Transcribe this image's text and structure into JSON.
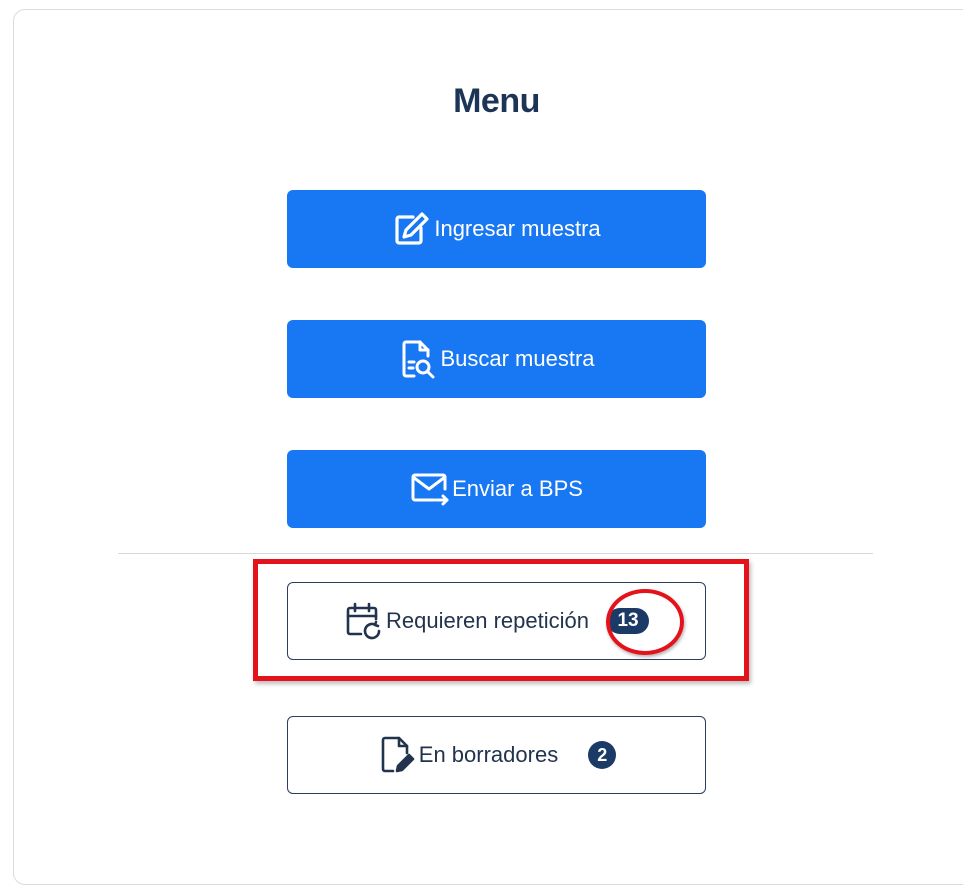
{
  "menu": {
    "title": "Menu",
    "buttons": [
      {
        "label": "Ingresar muestra",
        "icon": "edit-icon"
      },
      {
        "label": "Buscar muestra",
        "icon": "document-search-icon"
      },
      {
        "label": "Enviar a BPS",
        "icon": "mail-send-icon"
      }
    ],
    "status": [
      {
        "label": "Requieren repetición",
        "icon": "calendar-repeat-icon",
        "count": "13"
      },
      {
        "label": "En borradores",
        "icon": "document-edit-icon",
        "count": "2"
      }
    ]
  },
  "colors": {
    "primary": "#1877f2",
    "title": "#1c3556",
    "badge": "#1c3a66",
    "highlight": "#e3121b"
  }
}
